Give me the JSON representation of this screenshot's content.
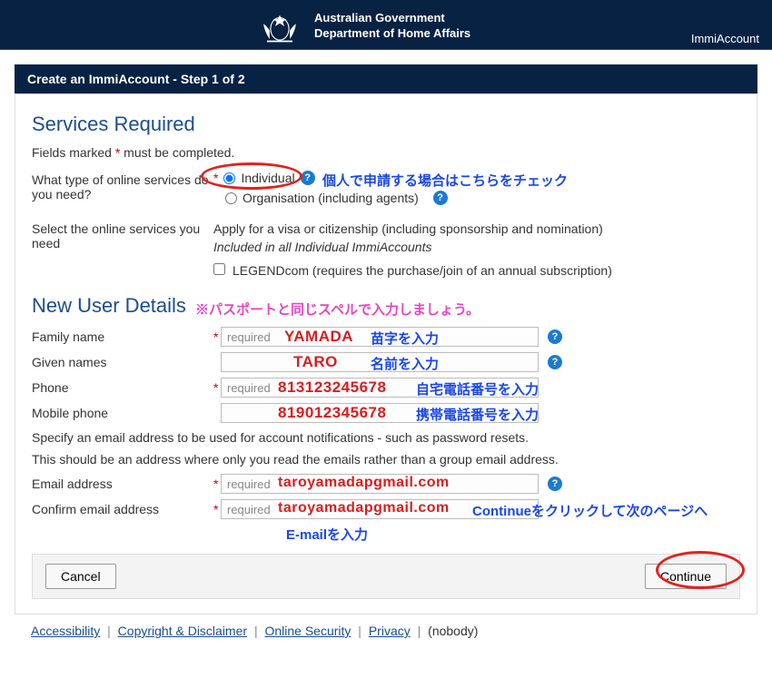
{
  "header": {
    "gov": "Australian Government",
    "dept": "Department of Home Affairs",
    "product": "ImmiAccount"
  },
  "panel_title": "Create an ImmiAccount - Step 1 of 2",
  "sections": {
    "services_heading": "Services Required",
    "required_note_pre": "Fields marked ",
    "required_note_post": " must be completed.",
    "q_service_type": "What type of online services do you need?",
    "opt_individual": "Individual",
    "opt_organisation": "Organisation (including agents)",
    "q_select_services": "Select the online services you need",
    "apply_text": "Apply for a visa or citizenship (including sponsorship and nomination)",
    "apply_sub": "Included in all Individual ImmiAccounts",
    "opt_legend": "LEGENDcom (requires the purchase/join of an annual subscription)",
    "newuser_heading": "New User Details",
    "f_family": "Family name",
    "f_given": "Given names",
    "f_phone": "Phone",
    "f_mobile": "Mobile phone",
    "placeholder_required": "required",
    "email_note1": "Specify an email address to be used for account notifications - such as password resets.",
    "email_note2": "This should be an address where only you read the emails rather than a group email address.",
    "f_email": "Email address",
    "f_email2": "Confirm email address",
    "btn_cancel": "Cancel",
    "btn_continue": "Continue"
  },
  "footer": {
    "accessibility": "Accessibility",
    "copyright": "Copyright & Disclaimer",
    "security": "Online Security",
    "privacy": "Privacy",
    "nobody": "(nobody)"
  },
  "annotations": {
    "individual_hint": "個人で申請する場合はこちらをチェック",
    "passport_hint": "※パスポートと同じスペルで入力しましょう。",
    "family_sample": "YAMADA",
    "family_label": "苗字を入力",
    "given_sample": "TARO",
    "given_label": "名前を入力",
    "phone_sample": "813123245678",
    "phone_label": "自宅電話番号を入力",
    "mobile_sample": "819012345678",
    "mobile_label": "携帯電話番号を入力",
    "email_sample": "taroyamadapgmail.com",
    "email2_sample": "taroyamadapgmail.com",
    "email_label": "E-mailを入力",
    "continue_hint": "Continueをクリックして次のページへ"
  }
}
